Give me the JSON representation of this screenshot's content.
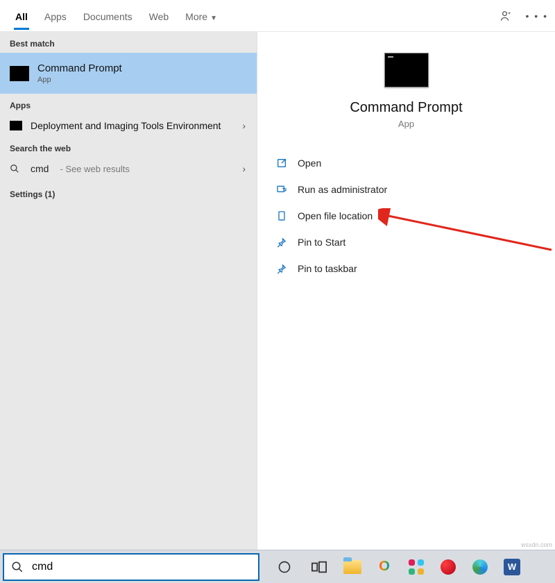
{
  "tabs": {
    "all": "All",
    "apps": "Apps",
    "documents": "Documents",
    "web": "Web",
    "more": "More"
  },
  "headings": {
    "best_match": "Best match",
    "apps": "Apps",
    "search_web": "Search the web",
    "settings": "Settings (1)"
  },
  "best": {
    "title": "Command Prompt",
    "type": "App"
  },
  "apps_item": {
    "title": "Deployment and Imaging Tools Environment"
  },
  "web": {
    "query": "cmd",
    "hint": "- See web results"
  },
  "detail": {
    "title": "Command Prompt",
    "type": "App"
  },
  "actions": {
    "open": "Open",
    "run_admin": "Run as administrator",
    "open_loc": "Open file location",
    "pin_start": "Pin to Start",
    "pin_taskbar": "Pin to taskbar"
  },
  "search": {
    "value": "cmd"
  },
  "watermark": "wsxdn.com"
}
